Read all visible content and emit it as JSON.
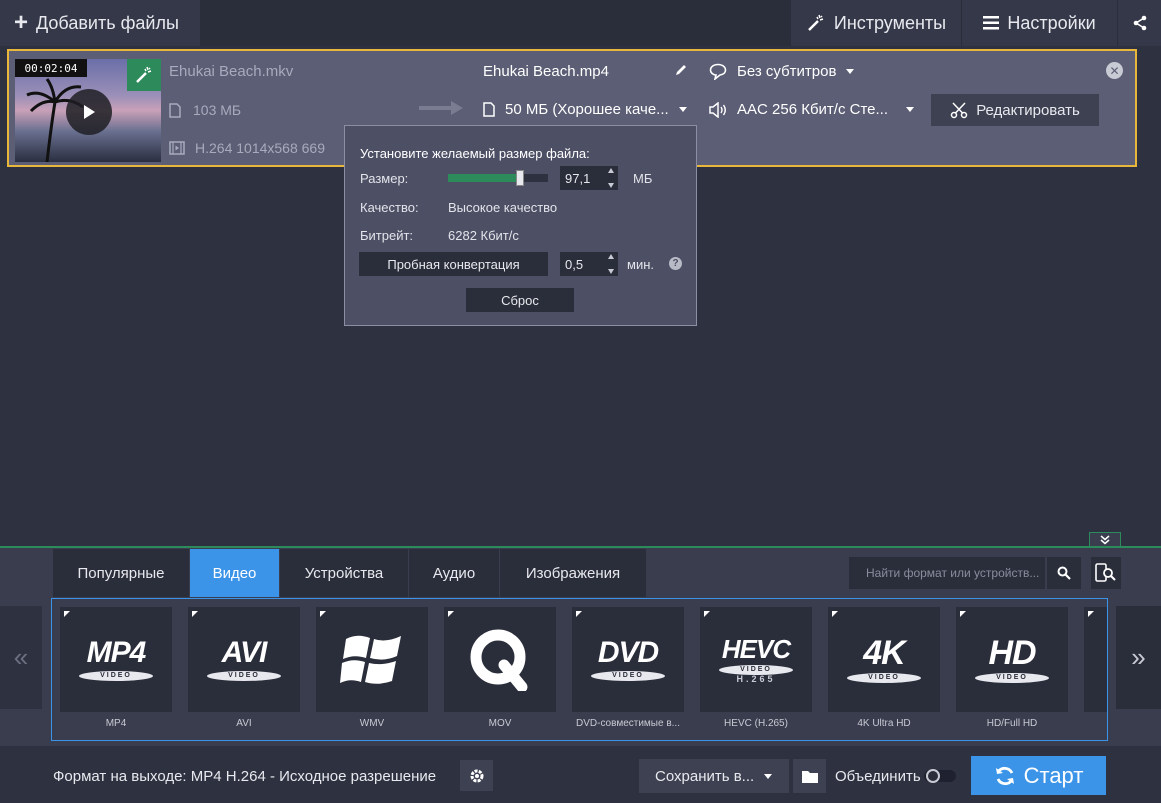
{
  "topbar": {
    "add_files": "Добавить файлы",
    "tools": "Инструменты",
    "settings": "Настройки"
  },
  "file": {
    "duration": "00:02:04",
    "source_name": "Ehukai Beach.mkv",
    "source_size": "103 МБ",
    "source_codec": "H.264 1014x568 669",
    "output_name": "Ehukai Beach.mp4",
    "output_size": "50 МБ (Хорошее каче...",
    "subtitles": "Без субтитров",
    "audio": "AAC 256 Кбит/с Сте...",
    "edit_label": "Редактировать"
  },
  "popup": {
    "title": "Установите желаемый размер файла:",
    "size_label": "Размер:",
    "size_value": "97,1",
    "size_unit": "МБ",
    "size_slider_fraction": 0.72,
    "quality_label": "Качество:",
    "quality_value": "Высокое качество",
    "bitrate_label": "Битрейт:",
    "bitrate_value": "6282 Кбит/с",
    "trial_label": "Пробная конвертация",
    "trial_value": "0,5",
    "trial_unit": "мин.",
    "reset_label": "Сброс"
  },
  "tabs": [
    {
      "label": "Популярные"
    },
    {
      "label": "Видео"
    },
    {
      "label": "Устройства"
    },
    {
      "label": "Аудио"
    },
    {
      "label": "Изображения"
    }
  ],
  "active_tab": "Видео",
  "search": {
    "placeholder": "Найти формат или устройств..."
  },
  "formats": [
    {
      "name": "MP4"
    },
    {
      "name": "AVI"
    },
    {
      "name": "WMV"
    },
    {
      "name": "MOV"
    },
    {
      "name": "DVD-совместимые в..."
    },
    {
      "name": "HEVC (H.265)"
    },
    {
      "name": "4K Ultra HD"
    },
    {
      "name": "HD/Full HD"
    }
  ],
  "logos": {
    "mp4": "MP4",
    "avi": "AVI",
    "dvd": "DVD",
    "hevc": "HEVC",
    "h265": "H.265",
    "k4": "4K",
    "hd": "HD",
    "video": "VIDEO"
  },
  "footer": {
    "output_format": "Формат на выходе: MP4 H.264 - Исходное разрешение",
    "save_label": "Сохранить в...",
    "merge_label": "Объединить",
    "start_label": "Старт"
  },
  "colors": {
    "accent": "#3b94e8",
    "selection_border": "#e8b63a",
    "green": "#2d8a5a"
  }
}
